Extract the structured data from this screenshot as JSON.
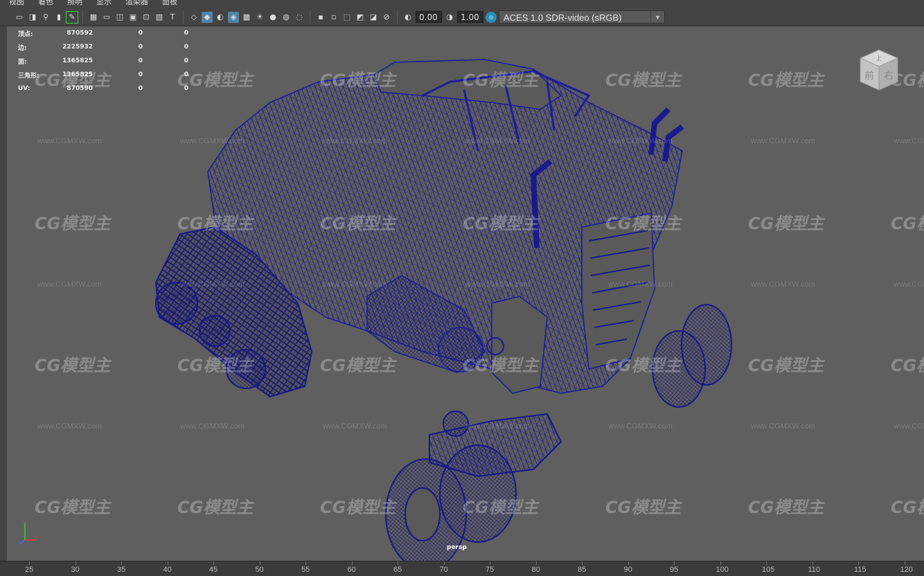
{
  "menubar": {
    "items": [
      "视图",
      "着色",
      "照明",
      "显示",
      "渲染器",
      "面板"
    ]
  },
  "toolbar": {
    "exposure_value": "0.00",
    "gamma_value": "1.00",
    "color_space": "ACES 1.0 SDR-video (sRGB)",
    "icons": [
      "camera-select-icon",
      "camera-attr-icon",
      "bookmark-icon",
      "image-plane-icon",
      "grease-pencil-icon",
      "grid-icon",
      "film-gate-icon",
      "resolution-gate-icon",
      "gate-mask-icon",
      "field-chart-icon",
      "safe-action-icon",
      "safe-title-icon",
      "wireframe-icon",
      "smooth-shade-icon",
      "default-material-icon",
      "wireframe-on-shaded-icon",
      "xray-icon",
      "lights-icon",
      "shadows-icon",
      "ambient-occlusion-icon",
      "motion-blur-icon",
      "anti-alias-icon",
      "depth-of-field-icon",
      "isolate-select-icon",
      "xray-joints-icon",
      "xray-active-icon",
      "backface-icon",
      "exposure-icon",
      "gamma-icon",
      "color-management-icon"
    ],
    "accent_color": "#5285a6"
  },
  "hud": {
    "rows": [
      {
        "label": "顶点:",
        "v1": "870592",
        "v2": "0",
        "v3": "0"
      },
      {
        "label": "边:",
        "v1": "2225932",
        "v2": "0",
        "v3": "0"
      },
      {
        "label": "面:",
        "v1": "1365825",
        "v2": "0",
        "v3": "0"
      },
      {
        "label": "三角形:",
        "v1": "1365825",
        "v2": "0",
        "v3": "0"
      },
      {
        "label": "UV:",
        "v1": "870590",
        "v2": "0",
        "v3": "0"
      }
    ]
  },
  "viewcube": {
    "front": "前",
    "right": "右",
    "top": "上"
  },
  "viewport": {
    "camera": "persp",
    "background_color": "#5f5f5f",
    "wire_color": "#1a1a8c"
  },
  "watermark": {
    "logo": "CG模型主",
    "url": "www.CGMXW.com"
  },
  "axis": {
    "x": "x",
    "y": "y",
    "z": "z"
  },
  "timeline": {
    "ticks": [
      "25",
      "30",
      "35",
      "40",
      "45",
      "50",
      "55",
      "60",
      "65",
      "70",
      "75",
      "80",
      "85",
      "90",
      "95",
      "100",
      "105",
      "110",
      "115",
      "120"
    ]
  }
}
